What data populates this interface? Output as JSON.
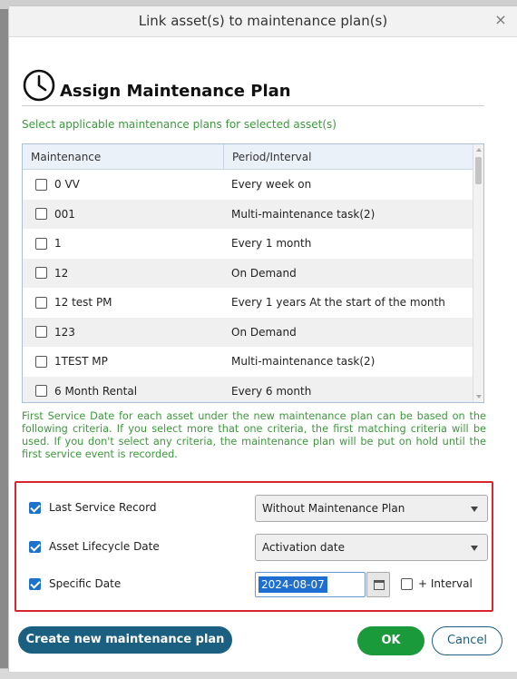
{
  "dialog": {
    "title": "Link asset(s) to maintenance plan(s)",
    "close_glyph": "×"
  },
  "heading": {
    "icon": "clock-icon",
    "text": "Assign Maintenance Plan"
  },
  "subtitle": "Select applicable maintenance plans for selected asset(s)",
  "table": {
    "columns": [
      "Maintenance",
      "Period/Interval"
    ],
    "rows": [
      {
        "name": "0 VV",
        "period": "Every week on",
        "checked": false
      },
      {
        "name": "001",
        "period": "Multi-maintenance task(2)",
        "checked": false
      },
      {
        "name": "1",
        "period": "Every 1 month",
        "checked": false
      },
      {
        "name": "12",
        "period": "On Demand",
        "checked": false
      },
      {
        "name": "12 test PM",
        "period": "Every 1 years At the start of the month",
        "checked": false
      },
      {
        "name": "123",
        "period": "On Demand",
        "checked": false
      },
      {
        "name": "1TEST MP",
        "period": "Multi-maintenance task(2)",
        "checked": false
      },
      {
        "name": "6 Month Rental",
        "period": "Every 6 month",
        "checked": false
      }
    ]
  },
  "info_text": "First Service Date for each asset under the new maintenance plan can be based on the following criteria. If you select more that one criteria, the first matching criteria will be used. If you don't select any criteria, the maintenance plan will be put on hold until the first service event is recorded.",
  "criteria": {
    "last_service": {
      "label": "Last Service Record",
      "checked": true,
      "selected": "Without Maintenance Plan"
    },
    "lifecycle": {
      "label": "Asset Lifecycle Date",
      "checked": true,
      "selected": "Activation date"
    },
    "specific": {
      "label": "Specific Date",
      "checked": true,
      "date_value": "2024-08-07"
    },
    "interval": {
      "label": "+ Interval",
      "checked": false
    }
  },
  "buttons": {
    "create": "Create new maintenance plan",
    "ok": "OK",
    "cancel": "Cancel"
  },
  "colors": {
    "accent_green": "#3a9a3a",
    "ok_green": "#1a9a3a",
    "primary_blue": "#1b5f81",
    "highlight_red": "#d9262c",
    "checkbox_blue": "#1d73c9"
  }
}
